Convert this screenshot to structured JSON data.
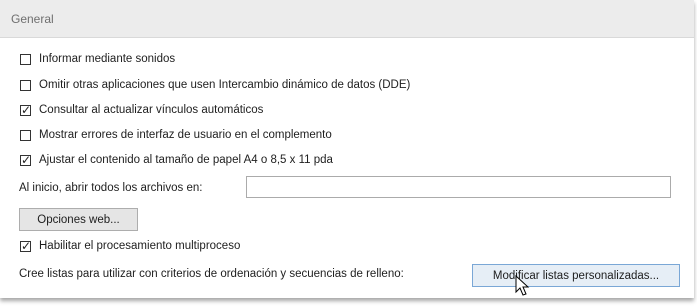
{
  "section": {
    "title": "General"
  },
  "options": [
    {
      "label": "Informar mediante sonidos",
      "checked": false
    },
    {
      "label": "Omitir otras aplicaciones que usen Intercambio dinámico de datos (DDE)",
      "checked": false
    },
    {
      "label": "Consultar al actualizar vínculos automáticos",
      "checked": true
    },
    {
      "label": "Mostrar errores de interfaz de usuario en el complemento",
      "checked": false
    },
    {
      "label": "Ajustar el contenido al tamaño de papel A4 o 8,5 x 11 pda",
      "checked": true
    }
  ],
  "startup": {
    "label": "Al inicio, abrir todos los archivos en:",
    "value": ""
  },
  "web_options_button": "Opciones web...",
  "multithread": {
    "label": "Habilitar el procesamiento multiproceso",
    "checked": true
  },
  "custom_lists": {
    "label": "Cree listas para utilizar con criterios de ordenación y secuencias de relleno:",
    "button": "Modificar listas personalizadas..."
  },
  "icons": {
    "checkmark": "check-icon",
    "cursor": "mouse-pointer-icon"
  }
}
